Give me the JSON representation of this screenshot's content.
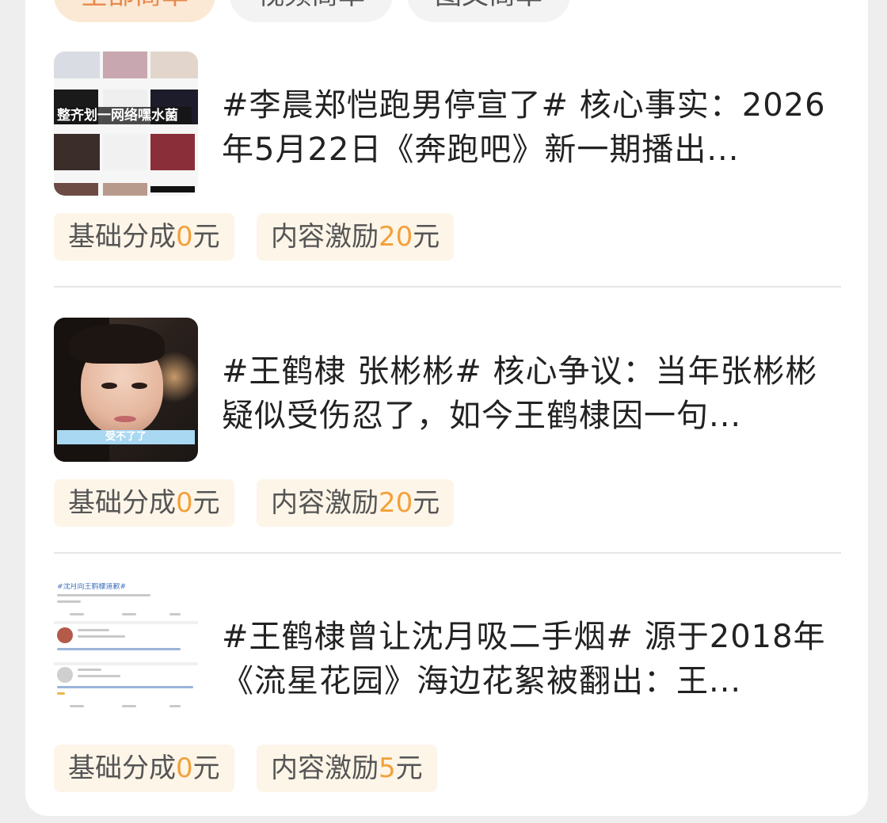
{
  "tabs": [
    {
      "label": "全部商单"
    },
    {
      "label": "视频商单"
    },
    {
      "label": "图文商单"
    }
  ],
  "tag_labels": {
    "base": "基础分成",
    "incentive": "内容激励",
    "unit": "元"
  },
  "items": [
    {
      "title": "#李晨郑恺跑男停宣了# 核心事实：2026年5月22日《奔跑吧》新一期播出...",
      "base_amount": "0",
      "incentive_amount": "20",
      "thumb_caption": "整齐划一网络嘿水菌"
    },
    {
      "title": "#王鹤棣 张彬彬# 核心争议：当年张彬彬疑似受伤忍了，如今王鹤棣因一句...",
      "base_amount": "0",
      "incentive_amount": "20",
      "thumb_caption": "受不了了"
    },
    {
      "title": "#王鹤棣曾让沈月吸二手烟# 源于2018年《流星花园》海边花絮被翻出：王...",
      "base_amount": "0",
      "incentive_amount": "5",
      "thumb_caption": "#沈月向王鹤棣道歉#"
    }
  ],
  "colors": {
    "accent": "#f2a13a",
    "tag_bg": "#fdf5e8",
    "active_tab_bg": "#fbe9d5"
  }
}
